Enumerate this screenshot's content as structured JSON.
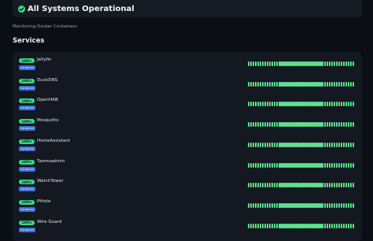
{
  "banner": {
    "title": "All Systems Operational",
    "icon": "check-circle-icon",
    "status_color": "#3ddc84"
  },
  "subtitle": "Monitoring Docker Containers",
  "section_title": "Services",
  "uptime_bar_color": "#5fe08f",
  "services": [
    {
      "uptime": "100%",
      "name": "Jellyfin",
      "type": "Container"
    },
    {
      "uptime": "100%",
      "name": "DuckDNS",
      "type": "Container"
    },
    {
      "uptime": "100%",
      "name": "OpenHAB",
      "type": "Container"
    },
    {
      "uptime": "100%",
      "name": "Mosquitto",
      "type": "Container"
    },
    {
      "uptime": "100%",
      "name": "HomeAssistant",
      "type": "Container"
    },
    {
      "uptime": "100%",
      "name": "Tasmoadmin",
      "type": "Container"
    },
    {
      "uptime": "100%",
      "name": "WatchTower",
      "type": "Container"
    },
    {
      "uptime": "100%",
      "name": "PiHole",
      "type": "Container"
    },
    {
      "uptime": "100%",
      "name": "Wire Guard",
      "type": "Container"
    }
  ]
}
